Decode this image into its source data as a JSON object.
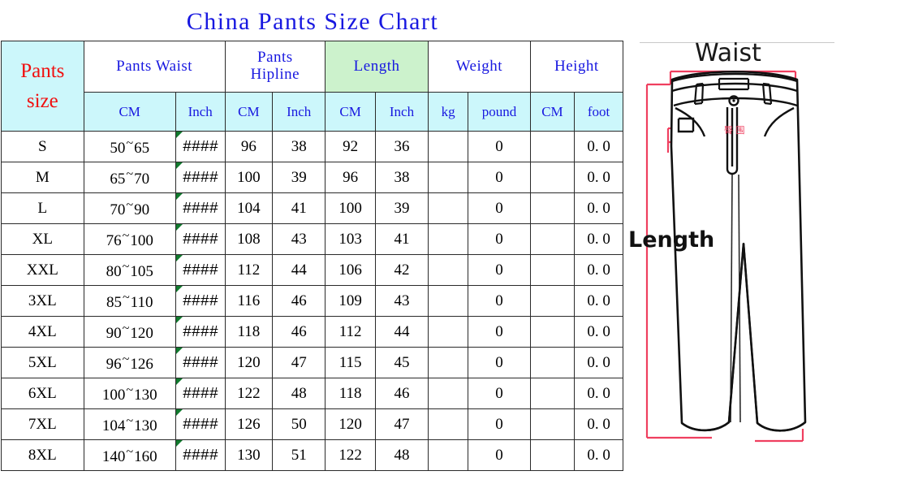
{
  "title": "China Pants Size Chart",
  "colors": {
    "title_blue": "#1818e0",
    "header_cyan": "#ccf7fb",
    "length_green": "#ccf2cc",
    "size_red": "#f01010",
    "measure_line_red": "#ef3f5f",
    "border": "#2a2a2a"
  },
  "table": {
    "size_header": {
      "line1": "Pants",
      "line2": "size"
    },
    "groups": [
      {
        "label": "Pants Waist",
        "highlight": false,
        "units": [
          "CM",
          "Inch"
        ]
      },
      {
        "label_line1": "Pants",
        "label_line2": "Hipline",
        "label": "Pants Hipline",
        "highlight": false,
        "units": [
          "CM",
          "Inch"
        ]
      },
      {
        "label": "Length",
        "highlight": true,
        "units": [
          "CM",
          "Inch"
        ]
      },
      {
        "label": "Weight",
        "highlight": false,
        "units": [
          "kg",
          "pound"
        ]
      },
      {
        "label": "Height",
        "highlight": false,
        "units": [
          "CM",
          "foot"
        ]
      }
    ],
    "unit_cells": [
      "CM",
      "Inch",
      "CM",
      "Inch",
      "CM",
      "Inch",
      "kg",
      "pound",
      "CM",
      "foot"
    ],
    "rows": [
      {
        "size": "S",
        "waist_cm": "50~65",
        "waist_inch": "####",
        "hip_cm": "96",
        "hip_inch": "38",
        "length_cm": "92",
        "length_inch": "36",
        "weight_kg": "",
        "weight_pound": "0",
        "height_cm": "",
        "height_foot": "0. 0"
      },
      {
        "size": "M",
        "waist_cm": "65~70",
        "waist_inch": "####",
        "hip_cm": "100",
        "hip_inch": "39",
        "length_cm": "96",
        "length_inch": "38",
        "weight_kg": "",
        "weight_pound": "0",
        "height_cm": "",
        "height_foot": "0. 0"
      },
      {
        "size": "L",
        "waist_cm": "70~90",
        "waist_inch": "####",
        "hip_cm": "104",
        "hip_inch": "41",
        "length_cm": "100",
        "length_inch": "39",
        "weight_kg": "",
        "weight_pound": "0",
        "height_cm": "",
        "height_foot": "0. 0"
      },
      {
        "size": "XL",
        "waist_cm": "76~100",
        "waist_inch": "####",
        "hip_cm": "108",
        "hip_inch": "43",
        "length_cm": "103",
        "length_inch": "41",
        "weight_kg": "",
        "weight_pound": "0",
        "height_cm": "",
        "height_foot": "0. 0"
      },
      {
        "size": "XXL",
        "waist_cm": "80~105",
        "waist_inch": "####",
        "hip_cm": "112",
        "hip_inch": "44",
        "length_cm": "106",
        "length_inch": "42",
        "weight_kg": "",
        "weight_pound": "0",
        "height_cm": "",
        "height_foot": "0. 0"
      },
      {
        "size": "3XL",
        "waist_cm": "85~110",
        "waist_inch": "####",
        "hip_cm": "116",
        "hip_inch": "46",
        "length_cm": "109",
        "length_inch": "43",
        "weight_kg": "",
        "weight_pound": "0",
        "height_cm": "",
        "height_foot": "0. 0"
      },
      {
        "size": "4XL",
        "waist_cm": "90~120",
        "waist_inch": "####",
        "hip_cm": "118",
        "hip_inch": "46",
        "length_cm": "112",
        "length_inch": "44",
        "weight_kg": "",
        "weight_pound": "0",
        "height_cm": "",
        "height_foot": "0. 0"
      },
      {
        "size": "5XL",
        "waist_cm": "96~126",
        "waist_inch": "####",
        "hip_cm": "120",
        "hip_inch": "47",
        "length_cm": "115",
        "length_inch": "45",
        "weight_kg": "",
        "weight_pound": "0",
        "height_cm": "",
        "height_foot": "0. 0"
      },
      {
        "size": "6XL",
        "waist_cm": "100~130",
        "waist_inch": "####",
        "hip_cm": "122",
        "hip_inch": "48",
        "length_cm": "118",
        "length_inch": "46",
        "weight_kg": "",
        "weight_pound": "0",
        "height_cm": "",
        "height_foot": "0. 0"
      },
      {
        "size": "7XL",
        "waist_cm": "104~130",
        "waist_inch": "####",
        "hip_cm": "126",
        "hip_inch": "50",
        "length_cm": "120",
        "length_inch": "47",
        "weight_kg": "",
        "weight_pound": "0",
        "height_cm": "",
        "height_foot": "0. 0"
      },
      {
        "size": "8XL",
        "waist_cm": "140~160",
        "waist_inch": "####",
        "hip_cm": "130",
        "hip_inch": "51",
        "length_cm": "122",
        "length_inch": "48",
        "weight_kg": "",
        "weight_pound": "0",
        "height_cm": "",
        "height_foot": "0. 0"
      }
    ]
  },
  "diagram": {
    "waist_label": "Waist",
    "length_label": "Length",
    "hip_annotation": "臀围"
  }
}
